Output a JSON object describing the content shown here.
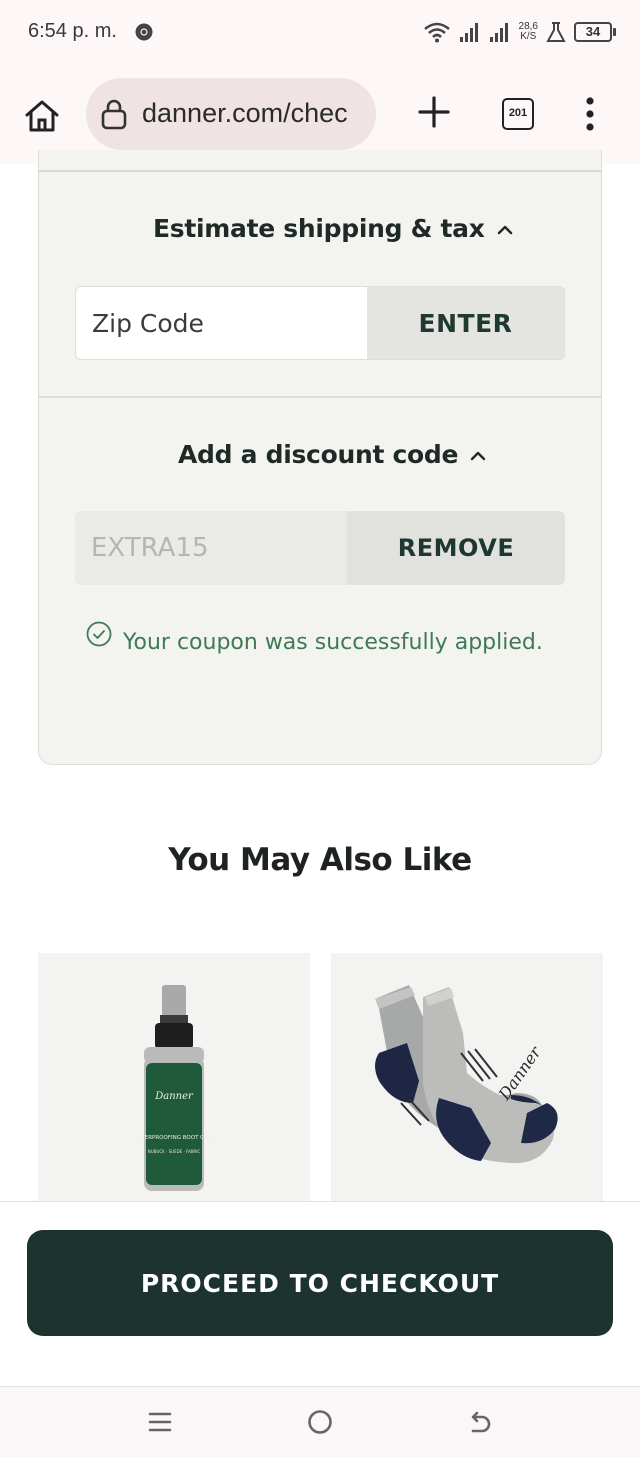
{
  "status_bar": {
    "time": "6:54 p. m.",
    "speed_value": "28,6",
    "speed_unit": "K/S",
    "battery": "34"
  },
  "browser": {
    "url": "danner.com/chec",
    "tab_count": "201"
  },
  "shipping": {
    "title": "Estimate shipping & tax",
    "zip_placeholder": "Zip Code",
    "enter_label": "ENTER"
  },
  "discount": {
    "title": "Add a discount code",
    "code_value": "EXTRA15",
    "remove_label": "REMOVE",
    "success_message": "Your coupon was successfully applied."
  },
  "recommendations": {
    "title": "You May Also Like",
    "products": [
      {
        "brand_label": "Danner",
        "product_text": "WATERPROOFING BOOT CARE",
        "sub_text": "NUBUCK · SUEDE · FABRIC"
      },
      {
        "brand_label": "Danner"
      }
    ]
  },
  "checkout": {
    "label": "PROCEED TO CHECKOUT"
  },
  "colors": {
    "brand_dark": "#1c3330",
    "success_green": "#3e7a55",
    "panel_bg": "#f3f3f0"
  }
}
